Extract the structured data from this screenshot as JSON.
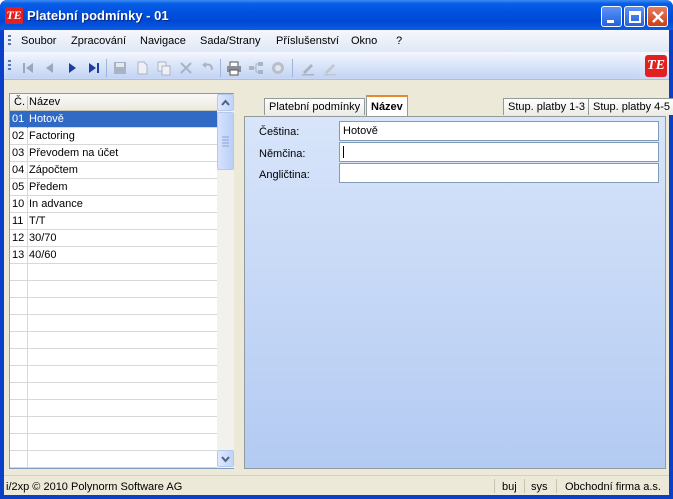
{
  "window": {
    "title": "Platební podmínky - 01"
  },
  "menu": [
    "Soubor",
    "Zpracování",
    "Navigace",
    "Sada/Strany",
    "Příslušenství",
    "Okno",
    "?"
  ],
  "toolbar": {
    "icons": [
      "first-record-icon",
      "prev-record-icon",
      "next-record-icon",
      "last-record-icon",
      "save-icon",
      "new-icon",
      "copy-icon",
      "delete-icon",
      "undo-icon",
      "print-icon",
      "tree-icon",
      "search-icon",
      "edit-icon",
      "erase-icon"
    ]
  },
  "list": {
    "header_num": "Č.",
    "header_name": "Název",
    "rows": [
      {
        "num": "01",
        "name": "Hotově"
      },
      {
        "num": "02",
        "name": "Factoring"
      },
      {
        "num": "03",
        "name": "Převodem na účet"
      },
      {
        "num": "04",
        "name": "Zápočtem"
      },
      {
        "num": "05",
        "name": "Předem"
      },
      {
        "num": "10",
        "name": "In advance"
      },
      {
        "num": "11",
        "name": "T/T"
      },
      {
        "num": "12",
        "name": "30/70"
      },
      {
        "num": "13",
        "name": "40/60"
      }
    ],
    "selected_index": 0
  },
  "tabs": [
    "Platební podmínky",
    "Název",
    "Stup. platby 1-3",
    "Stup. platby 4-5"
  ],
  "active_tab": "Název",
  "form": {
    "cestina_label": "Čeština:",
    "cestina_value": "Hotově",
    "nemcina_label": "Němčina:",
    "nemcina_value": "",
    "anglictina_label": "Angličtina:",
    "anglictina_value": ""
  },
  "status": {
    "copyright": "i/2xp © 2010 Polynorm Software AG",
    "user": "buj",
    "db": "sys",
    "company": "Obchodní firma a.s."
  }
}
